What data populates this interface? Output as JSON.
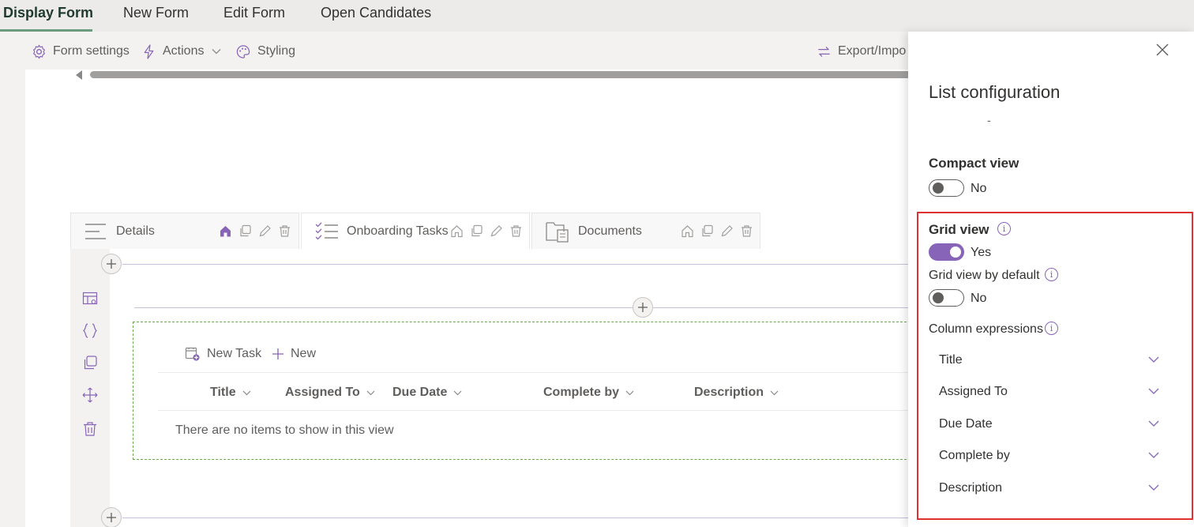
{
  "form_tabs": [
    {
      "label": "Display Form",
      "active": true
    },
    {
      "label": "New Form",
      "active": false
    },
    {
      "label": "Edit Form",
      "active": false
    },
    {
      "label": "Open Candidates",
      "active": false
    }
  ],
  "command_bar": {
    "form_settings": "Form settings",
    "actions": "Actions",
    "styling": "Styling",
    "export_import": "Export/Impo"
  },
  "section_tabs": [
    {
      "label": "Details",
      "icon": "list-lines-icon"
    },
    {
      "label": "Onboarding Tasks",
      "icon": "checklist-icon"
    },
    {
      "label": "Documents",
      "icon": "folder-documents-icon"
    }
  ],
  "list": {
    "new_task": "New Task",
    "new": "New",
    "columns": [
      "Title",
      "Assigned To",
      "Due Date",
      "Complete by",
      "Description"
    ],
    "empty_message": "There are no items to show in this view"
  },
  "panel": {
    "title": "List configuration",
    "dash": "-",
    "compact_view": {
      "label": "Compact view",
      "value": "No",
      "on": false
    },
    "grid_view": {
      "label": "Grid view",
      "value": "Yes",
      "on": true
    },
    "grid_view_default": {
      "label": "Grid view by default",
      "value": "No",
      "on": false
    },
    "column_expressions": {
      "label": "Column expressions",
      "items": [
        "Title",
        "Assigned To",
        "Due Date",
        "Complete by",
        "Description"
      ]
    }
  },
  "colors": {
    "accent": "#8764b8",
    "active_tab_underline": "#6a9b7e",
    "highlight_border": "#e03131",
    "list_border": "#6aa84f"
  }
}
